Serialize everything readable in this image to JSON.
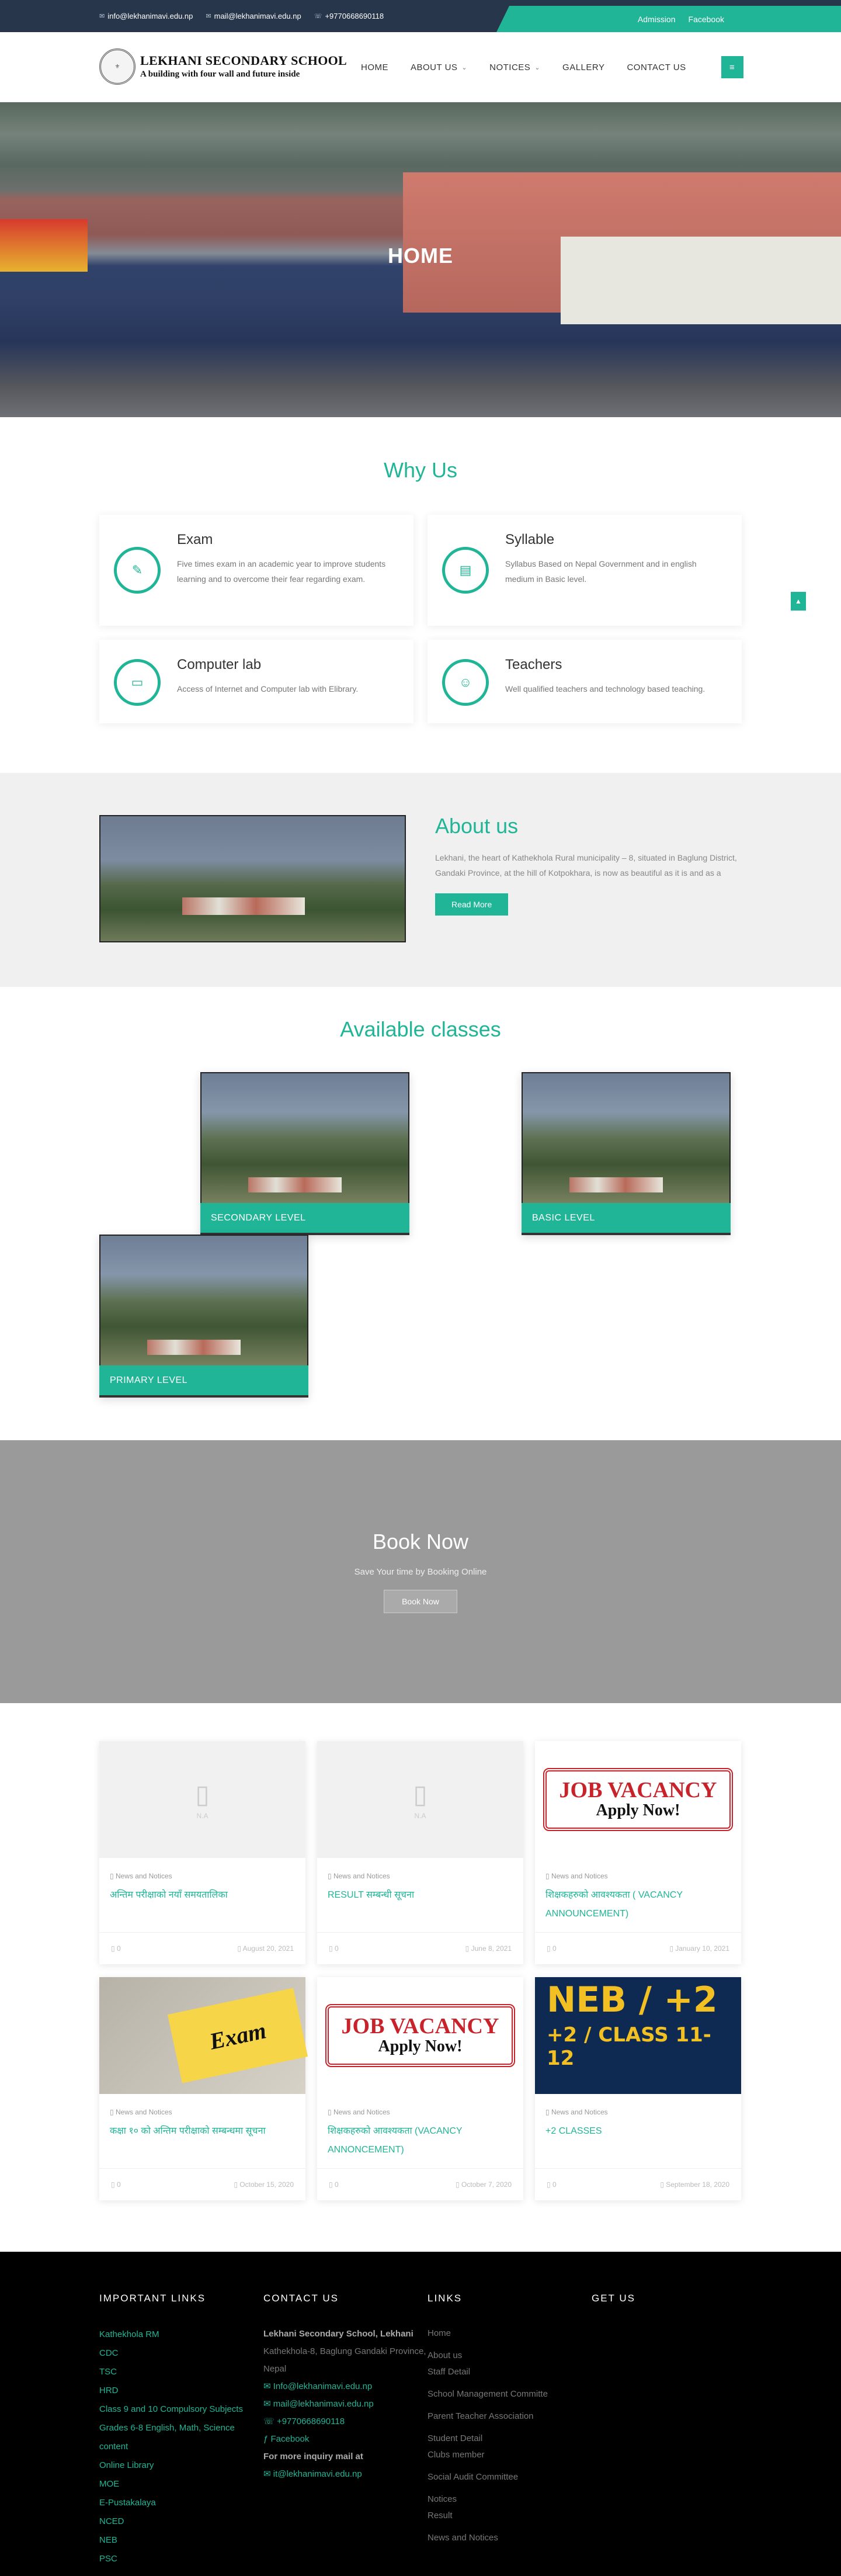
{
  "topbar": {
    "email1": "info@lekhanimavi.edu.np",
    "email2": "mail@lekhanimavi.edu.np",
    "phone": "+9770668690118",
    "admission": "Admission",
    "facebook": "Facebook"
  },
  "logo": {
    "name": "LEKHANI SECONDARY SCHOOL",
    "tagline": "A building with four wall and future inside"
  },
  "nav": [
    "HOME",
    "ABOUT US",
    "NOTICES",
    "GALLERY",
    "CONTACT US"
  ],
  "hero": {
    "title": "HOME"
  },
  "why": {
    "title": "Why Us",
    "cards": [
      {
        "title": "Exam",
        "text": "Five times exam in an academic year to improve students learning and to overcome their fear regarding exam."
      },
      {
        "title": "Syllable",
        "text": "Syllabus Based on Nepal Government and in english medium in Basic level."
      },
      {
        "title": "Computer lab",
        "text": "Access of Internet and Computer lab with Elibrary."
      },
      {
        "title": "Teachers",
        "text": "Well qualified teachers and technology based teaching."
      }
    ]
  },
  "about": {
    "title": "About us",
    "text": "Lekhani, the heart of Kathekhola Rural municipality – 8, situated in Baglung District, Gandaki Province, at the hill of Kotpokhara, is now as beautiful as it is and as a",
    "button": "Read More"
  },
  "classes": {
    "title": "Available classes",
    "items": [
      "SECONDARY LEVEL",
      "BASIC LEVEL",
      "PRIMARY LEVEL"
    ]
  },
  "book": {
    "title": "Book Now",
    "text": "Save Your time by Booking Online",
    "button": "Book Now"
  },
  "news": {
    "placeholder_label": "N.A",
    "posts": [
      {
        "category": "News and Notices",
        "title": "अन्तिम परीक्षाको नयाँ समयतालिका",
        "comments": "0",
        "date": "August 20, 2021"
      },
      {
        "category": "News and Notices",
        "title": "RESULT सम्बन्धी सूचना",
        "comments": "0",
        "date": "June 8, 2021"
      },
      {
        "category": "News and Notices",
        "title": "शिक्षकहरुको आवश्यकता ( VACANCY ANNOUNCEMENT)",
        "comments": "0",
        "date": "January 10, 2021"
      },
      {
        "category": "News and Notices",
        "title": "कक्षा १० को अन्तिम परीक्षाको सम्बन्धमा सूचना",
        "comments": "0",
        "date": "October 15, 2020"
      },
      {
        "category": "News and Notices",
        "title": "शिक्षकहरुको आवश्यकता (VACANCY ANNONCEMENT)",
        "comments": "0",
        "date": "October 7, 2020"
      },
      {
        "category": "News and Notices",
        "title": "+2 CLASSES",
        "comments": "0",
        "date": "September 18, 2020"
      }
    ],
    "vacancy_line1": "JOB VACANCY",
    "vacancy_line2": "Apply Now!",
    "exam_word": "Exam",
    "neb_line1": "NEB / +2",
    "neb_line2": "+2 / CLASS 11-12"
  },
  "footer": {
    "important_title": "IMPORTANT LINKS",
    "important_links": [
      "Kathekhola RM",
      "CDC",
      "TSC",
      "HRD",
      "Class 9 and 10 Compulsory Subjects",
      "Grades 6-8 English, Math, Science content",
      "Online Library",
      "MOE",
      "E-Pustakalaya",
      "NCED",
      "NEB",
      "PSC"
    ],
    "contact_title": "CONTACT US",
    "contact_name": "Lekhani Secondary School, Lekhani",
    "contact_address": "Kathekhola-8, Baglung Gandaki Province, Nepal",
    "contact_email1": "Info@lekhanimavi.edu.np",
    "contact_email2": "mail@lekhanimavi.edu.np",
    "contact_phone": "+9770668690118",
    "contact_facebook": "Facebook",
    "inquiry_label": "For more inquiry mail at",
    "inquiry_email": "it@lekhanimavi.edu.np",
    "links_title": "LINKS",
    "links": [
      "Home",
      "About us",
      "Staff Detail",
      "School Management Committe",
      "Parent Teacher Association",
      "Student Detail",
      "Clubs member",
      "Social Audit Committee",
      "Notices",
      "Result",
      "News and Notices"
    ],
    "get_title": "GET US"
  }
}
